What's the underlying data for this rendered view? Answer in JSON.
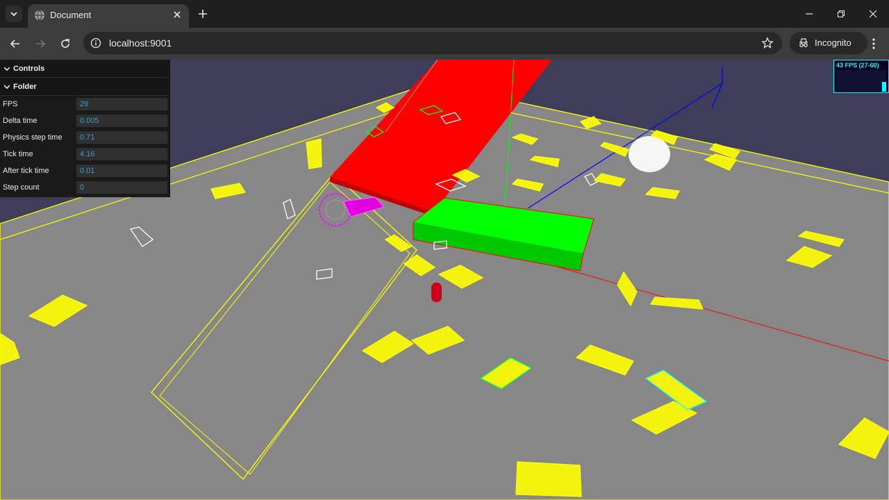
{
  "browser": {
    "tab_title": "Document",
    "url": "localhost:9001",
    "incognito_label": "Incognito"
  },
  "gui": {
    "controls_label": "Controls",
    "folder_label": "Folder",
    "rows": [
      {
        "label": "FPS",
        "value": "29"
      },
      {
        "label": "Delta time",
        "value": "0.005"
      },
      {
        "label": "Physics step time",
        "value": "0.71"
      },
      {
        "label": "Tick time",
        "value": "4.16"
      },
      {
        "label": "After tick time",
        "value": "0.01"
      },
      {
        "label": "Step count",
        "value": "0"
      }
    ]
  },
  "stats": {
    "text": "43 FPS (27-60)"
  },
  "colors": {
    "floor": "#878787",
    "background": "#3e3e5a",
    "wire": "#ffff00",
    "red_block": "#ff0000",
    "green_block": "#00ff00",
    "magenta": "#ff00ff",
    "cyan_text": "#00ffff"
  }
}
